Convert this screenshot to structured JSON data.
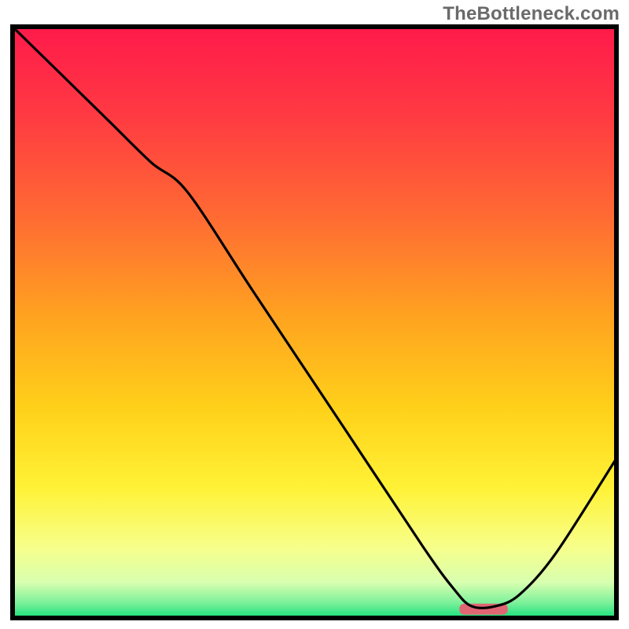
{
  "watermark": "TheBottleneck.com",
  "chart_data": {
    "type": "line",
    "title": "",
    "xlabel": "",
    "ylabel": "",
    "xlim": [
      0,
      100
    ],
    "ylim": [
      0,
      100
    ],
    "grid": false,
    "legend": false,
    "annotations": [],
    "background_gradient": {
      "direction": "vertical",
      "stops": [
        {
          "offset": 0.0,
          "color": "#ff1a4b"
        },
        {
          "offset": 0.15,
          "color": "#ff3a42"
        },
        {
          "offset": 0.32,
          "color": "#ff6a33"
        },
        {
          "offset": 0.5,
          "color": "#ffa61f"
        },
        {
          "offset": 0.65,
          "color": "#ffd21a"
        },
        {
          "offset": 0.78,
          "color": "#fff236"
        },
        {
          "offset": 0.88,
          "color": "#f7ff8a"
        },
        {
          "offset": 0.94,
          "color": "#d8ffb0"
        },
        {
          "offset": 0.975,
          "color": "#7af09a"
        },
        {
          "offset": 1.0,
          "color": "#17e07a"
        }
      ]
    },
    "curve": {
      "description": "Bottleneck curve: high at low-x, falls to minimum near the highlighted band, rises again toward high-x",
      "x": [
        0,
        8,
        16,
        23,
        29,
        40,
        55,
        68,
        73,
        76,
        80,
        84,
        90,
        100
      ],
      "y": [
        100,
        92,
        84,
        77,
        72,
        55,
        32,
        12,
        5,
        2,
        2,
        4,
        11,
        27
      ]
    },
    "highlight_band": {
      "description": "Optimal (zero-bottleneck) x-range marker",
      "x_start": 74,
      "x_end": 82,
      "y": 1.5,
      "color": "#e06673"
    },
    "frame": {
      "stroke": "#000000",
      "stroke_width": 6
    }
  }
}
